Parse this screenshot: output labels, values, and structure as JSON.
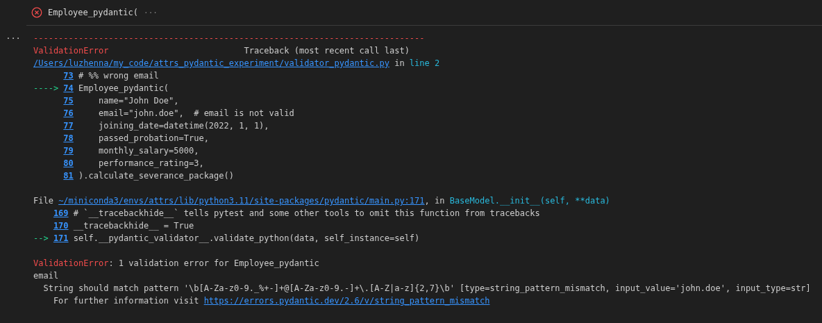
{
  "cell": {
    "kind": "error",
    "title": "Employee_pydantic(",
    "overflow": "···"
  },
  "more_button": "···",
  "output": [
    {
      "kind": "frame",
      "arrow": "---->",
      "header": [
        [
          {
            "kind": "error",
            "text": "------------------------------------------------------------------------------"
          }
        ],
        [
          {
            "kind": "error",
            "text": "ValidationError"
          },
          {
            "kind": "plain",
            "text": "                           Traceback (most recent call last)"
          }
        ],
        [
          {
            "kind": "link",
            "text": "/Users/luzhenna/my_code/attrs_pydantic_experiment/validator_pydantic.py"
          },
          {
            "kind": "plain",
            "text": " in "
          },
          {
            "kind": "location",
            "text": "line 2"
          }
        ]
      ],
      "source": [
        {
          "number": "73",
          "code": "# %% wrong email",
          "current": false
        },
        {
          "number": "74",
          "code": "Employee_pydantic(",
          "current": true
        },
        {
          "number": "75",
          "code": "    name=\"John Doe\",",
          "current": false
        },
        {
          "number": "76",
          "code": "    email=\"john.doe\",  # email is not valid",
          "current": false
        },
        {
          "number": "77",
          "code": "    joining_date=datetime(2022, 1, 1),",
          "current": false
        },
        {
          "number": "78",
          "code": "    passed_probation=True,",
          "current": false
        },
        {
          "number": "79",
          "code": "    monthly_salary=5000,",
          "current": false
        },
        {
          "number": "80",
          "code": "    performance_rating=3,",
          "current": false
        },
        {
          "number": "81",
          "code": ").calculate_severance_package()",
          "current": false
        }
      ]
    },
    {
      "kind": "frame",
      "arrow": "-->",
      "header": [
        [
          {
            "kind": "plain",
            "text": "File "
          },
          {
            "kind": "link",
            "text": "~/miniconda3/envs/attrs/lib/python3.11/site-packages/pydantic/main.py:171"
          },
          {
            "kind": "plain",
            "text": ", in "
          },
          {
            "kind": "location",
            "text": "BaseModel.__init__(self, **data)"
          }
        ]
      ],
      "source": [
        {
          "number": "169",
          "code": "# `__tracebackhide__` tells pytest and some other tools to omit this function from tracebacks",
          "current": false
        },
        {
          "number": "170",
          "code": "__tracebackhide__ = True",
          "current": false
        },
        {
          "number": "171",
          "code": "self.__pydantic_validator__.validate_python(data, self_instance=self)",
          "current": true
        }
      ]
    },
    {
      "kind": "text",
      "lines": [
        [
          {
            "kind": "error",
            "text": "ValidationError"
          },
          {
            "kind": "plain",
            "text": ": 1 validation error for Employee_pydantic"
          }
        ],
        [
          {
            "kind": "plain",
            "text": "email"
          }
        ],
        [
          {
            "kind": "plain",
            "text": "  String should match pattern '\\b[A-Za-z0-9._%+-]+@[A-Za-z0-9.-]+\\.[A-Z|a-z]{2,7}\\b' [type=string_pattern_mismatch, input_value='john.doe', input_type=str]"
          }
        ],
        [
          {
            "kind": "plain",
            "text": "    For further information visit "
          },
          {
            "kind": "link",
            "text": "https://errors.pydantic.dev/2.6/v/string_pattern_mismatch"
          }
        ]
      ]
    }
  ]
}
